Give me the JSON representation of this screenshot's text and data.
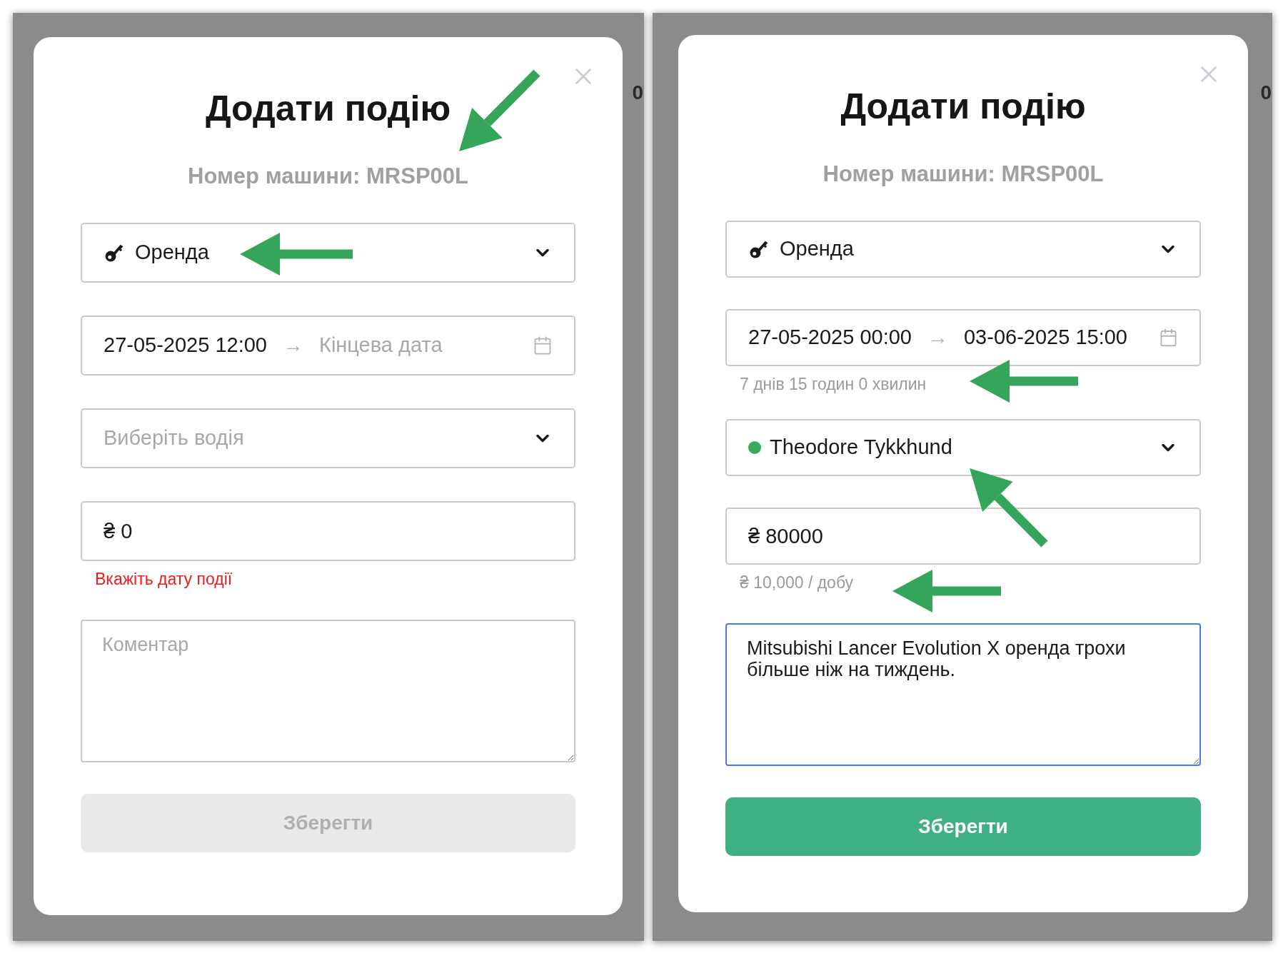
{
  "panels": [
    {
      "peek_text": "0",
      "modal": {
        "title": "Додати подію",
        "subtitle": "Номер машини: MRSP00L",
        "event_type": {
          "label": "Оренда"
        },
        "date_range": {
          "start": "27-05-2025 12:00",
          "separator": "→",
          "end_placeholder": "Кінцева дата"
        },
        "driver": {
          "placeholder": "Виберіть водія"
        },
        "price": {
          "value": "₴ 0"
        },
        "error": "Вкажіть дату події",
        "comment": {
          "placeholder": "Коментар",
          "focused": false
        },
        "save": {
          "label": "Зберегти",
          "disabled": true
        }
      }
    },
    {
      "peek_text": "0",
      "modal": {
        "title": "Додати подію",
        "subtitle": "Номер машини: MRSP00L",
        "event_type": {
          "label": "Оренда"
        },
        "date_range": {
          "start": "27-05-2025 00:00",
          "separator": "→",
          "end": "03-06-2025 15:00"
        },
        "duration": "7 днів 15 годин 0 хвилин",
        "driver": {
          "value": "Theodore Tykkhund",
          "color": "#3aa95e"
        },
        "price": {
          "value": "₴ 80000"
        },
        "price_hint": "₴ 10,000 / добу",
        "comment": {
          "value": "Mitsubishi Lancer Evolution X оренда трохи більше ніж на тиждень.",
          "focused": true
        },
        "save": {
          "label": "Зберегти",
          "disabled": false
        }
      }
    }
  ]
}
